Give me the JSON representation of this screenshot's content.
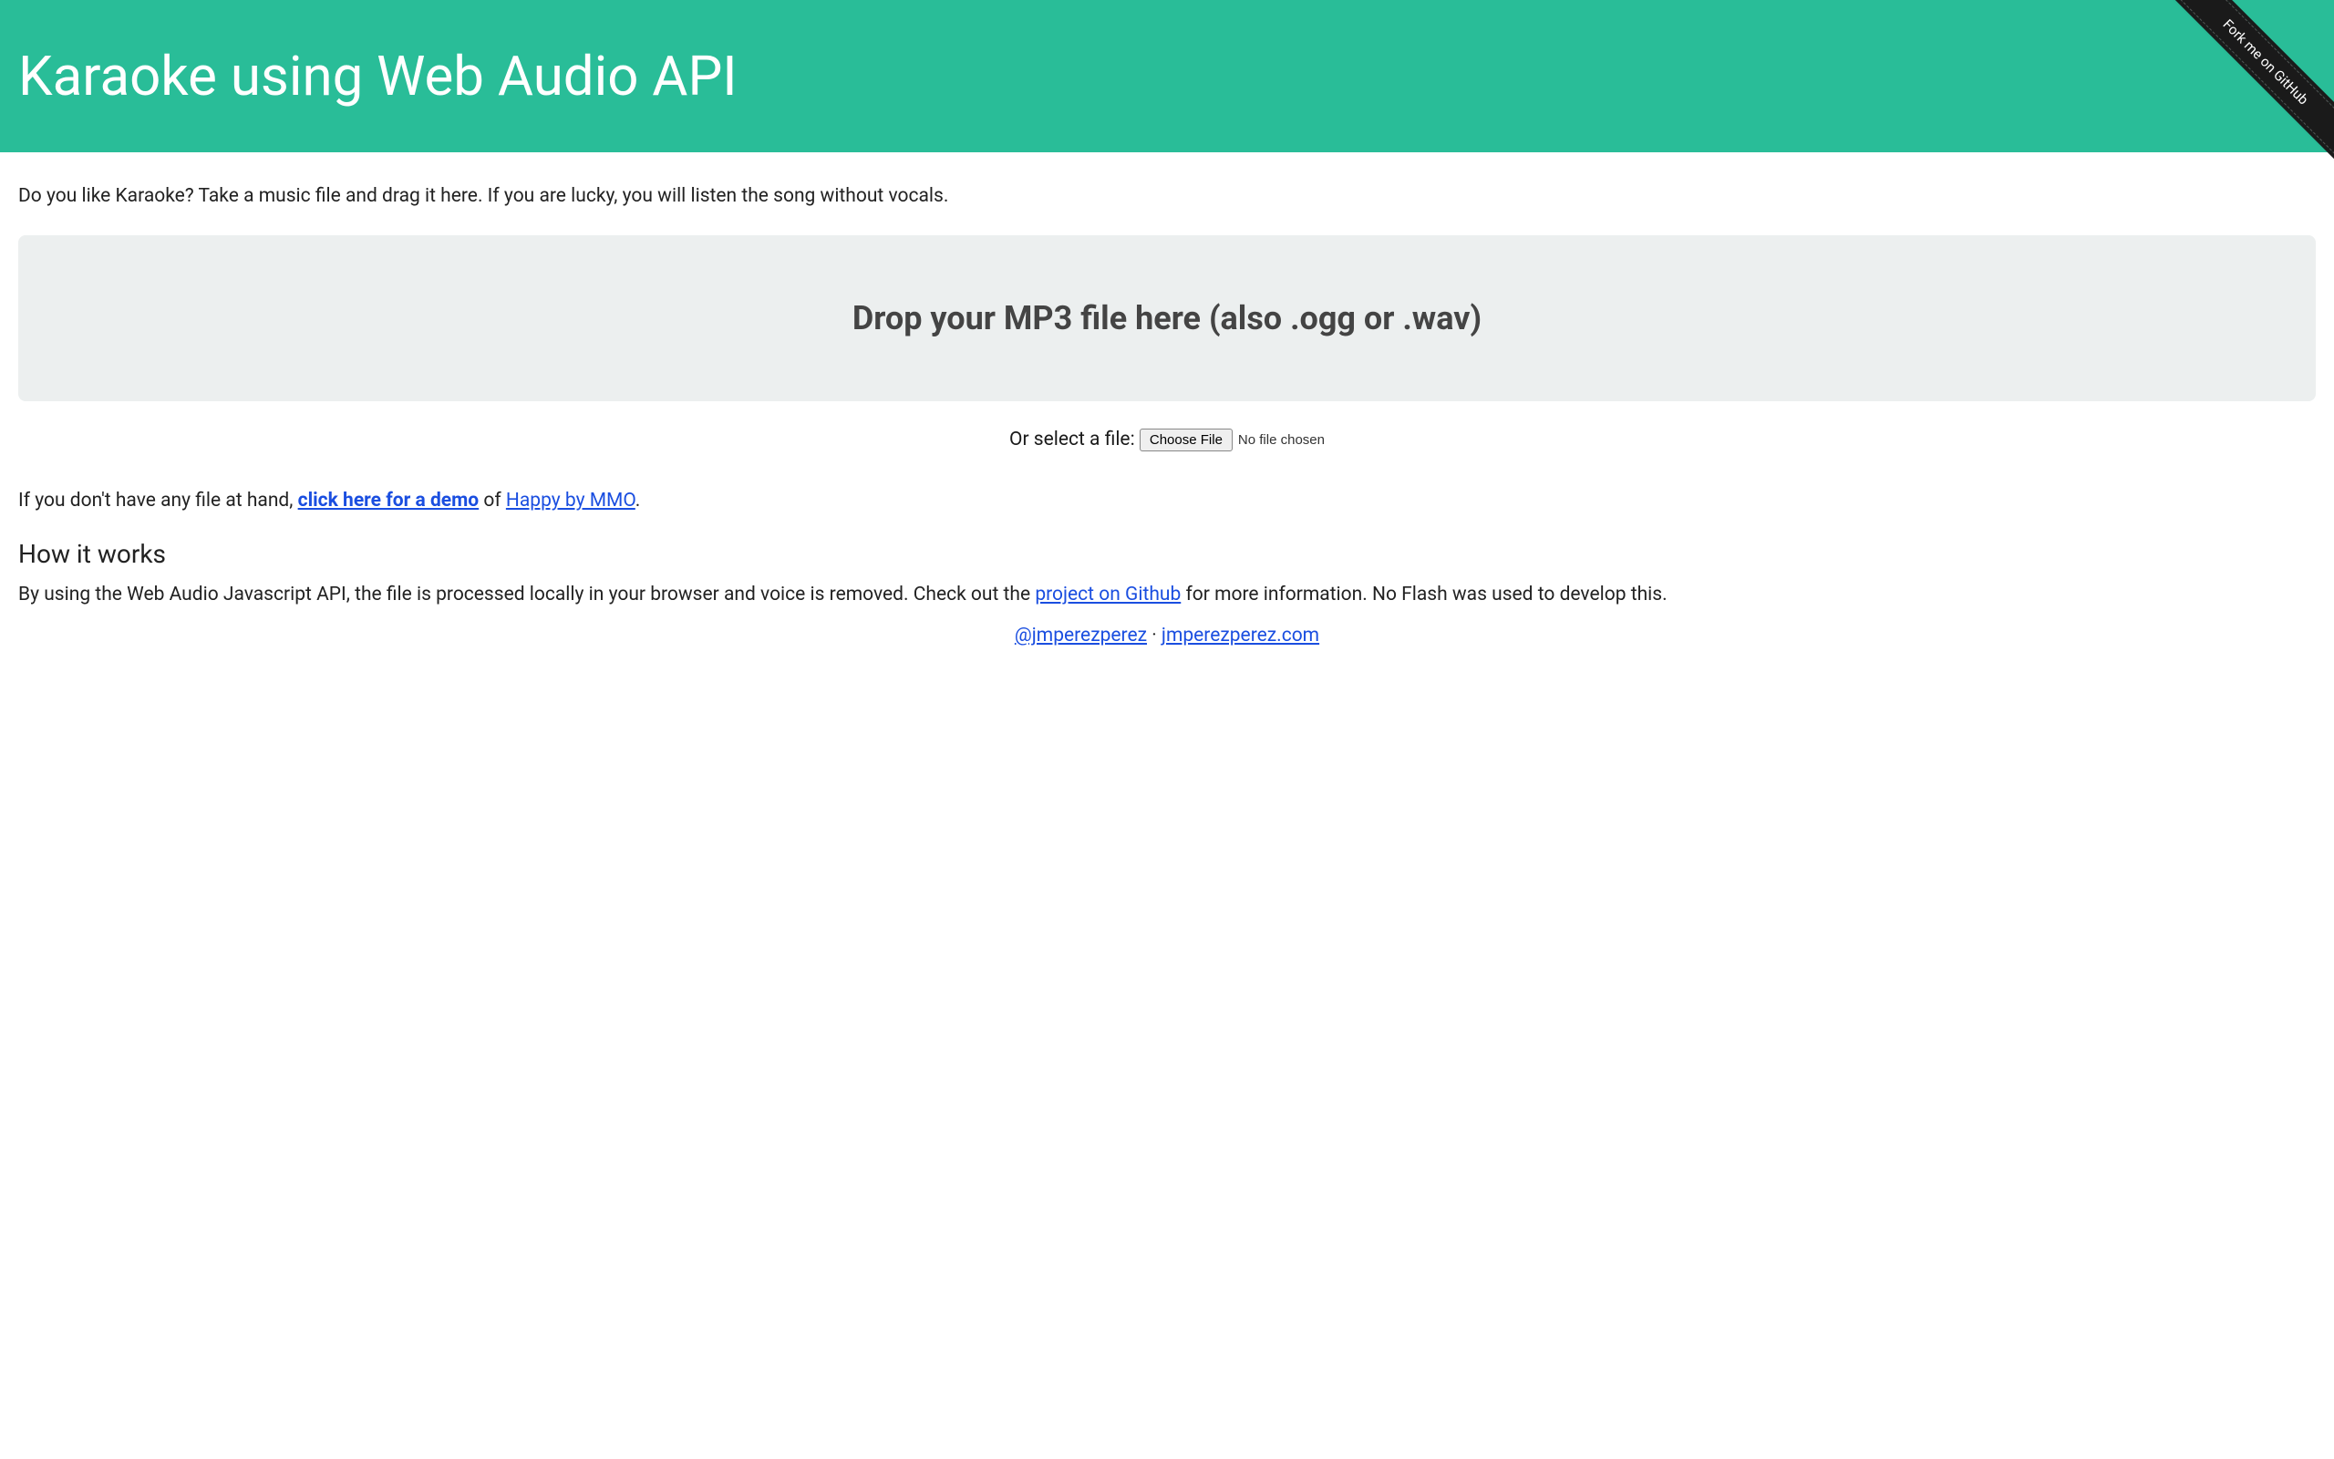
{
  "header": {
    "title": "Karaoke using Web Audio API",
    "github_ribbon": "Fork me on GitHub"
  },
  "main": {
    "intro": "Do you like Karaoke? Take a music file and drag it here. If you are lucky, you will listen the song without vocals.",
    "dropzone_text": "Drop your MP3 file here (also .ogg or .wav)",
    "file_select_label": "Or select a file: ",
    "choose_file_button": "Choose File",
    "file_status": "No file chosen",
    "demo_prefix": "If you don't have any file at hand, ",
    "demo_link": "click here for a demo",
    "demo_middle": " of ",
    "demo_song_link": "Happy by MMO",
    "demo_suffix": ".",
    "how_it_works_heading": "How it works",
    "how_it_works_prefix": "By using the Web Audio Javascript API, the file is processed locally in your browser and voice is removed. Check out the ",
    "project_link": "project on Github",
    "how_it_works_suffix": " for more information. No Flash was used to develop this."
  },
  "footer": {
    "twitter": "@jmperezperez",
    "separator": " · ",
    "site": "jmperezperez.com"
  }
}
